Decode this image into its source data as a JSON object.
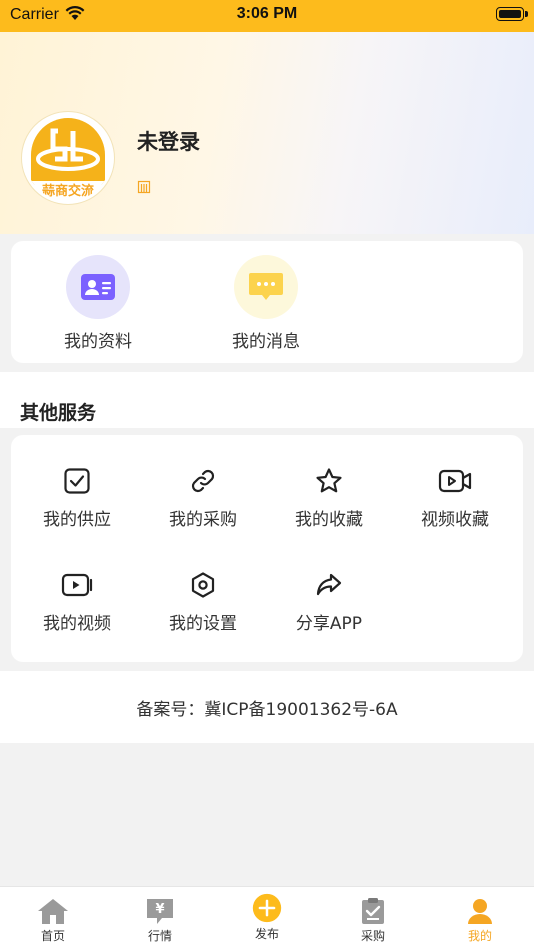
{
  "status_bar": {
    "carrier": "Carrier",
    "time": "3:06 PM"
  },
  "profile": {
    "name": "未登录",
    "avatar_text": "蒜商交流"
  },
  "quick_actions": [
    {
      "label": "我的资料",
      "icon": "id-card-icon"
    },
    {
      "label": "我的消息",
      "icon": "message-icon"
    }
  ],
  "services": {
    "title": "其他服务",
    "items": [
      {
        "label": "我的供应",
        "icon": "checkbox-icon"
      },
      {
        "label": "我的采购",
        "icon": "link-icon"
      },
      {
        "label": "我的收藏",
        "icon": "star-icon"
      },
      {
        "label": "视频收藏",
        "icon": "video-camera-icon"
      },
      {
        "label": "我的视频",
        "icon": "play-video-icon"
      },
      {
        "label": "我的设置",
        "icon": "settings-hexagon-icon"
      },
      {
        "label": "分享APP",
        "icon": "share-arrow-icon"
      }
    ]
  },
  "record_number": "备案号：冀ICP备19001362号-6A",
  "tabbar": {
    "items": [
      {
        "label": "首页",
        "icon": "home-icon"
      },
      {
        "label": "行情",
        "icon": "market-yen-icon"
      },
      {
        "label": "发布",
        "icon": "publish-plus-icon"
      },
      {
        "label": "采购",
        "icon": "purchase-clipboard-icon"
      },
      {
        "label": "我的",
        "icon": "profile-person-icon"
      }
    ],
    "active": "我的"
  },
  "colors": {
    "brand": "#fdbb1c",
    "active_tab": "#f5a623",
    "id_card": "#7b61ff",
    "message": "#fcd34d"
  }
}
